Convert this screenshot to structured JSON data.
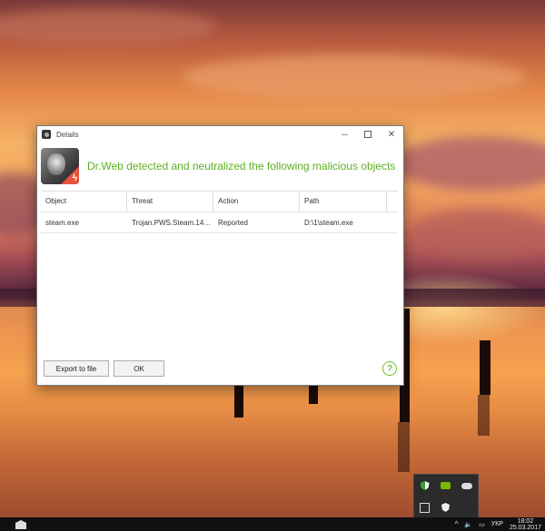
{
  "dialog": {
    "title": "Details",
    "headline": "Dr.Web detected and neutralized the following malicious objects",
    "columns": [
      "Object",
      "Threat",
      "Action",
      "Path"
    ],
    "rows": [
      {
        "object": "steam.exe",
        "threat": "Trojan.PWS.Steam.143…",
        "action": "Reported",
        "path": "D:\\1\\steam.exe"
      }
    ],
    "export_button": "Export to file",
    "ok_button": "OK",
    "help_label": "?"
  },
  "taskbar": {
    "language": "УКР",
    "time": "18:02",
    "date": "25.03.2017",
    "overflow_chevron": "^"
  },
  "colors": {
    "headline": "#5cb11f",
    "help": "#6fbf2d"
  }
}
